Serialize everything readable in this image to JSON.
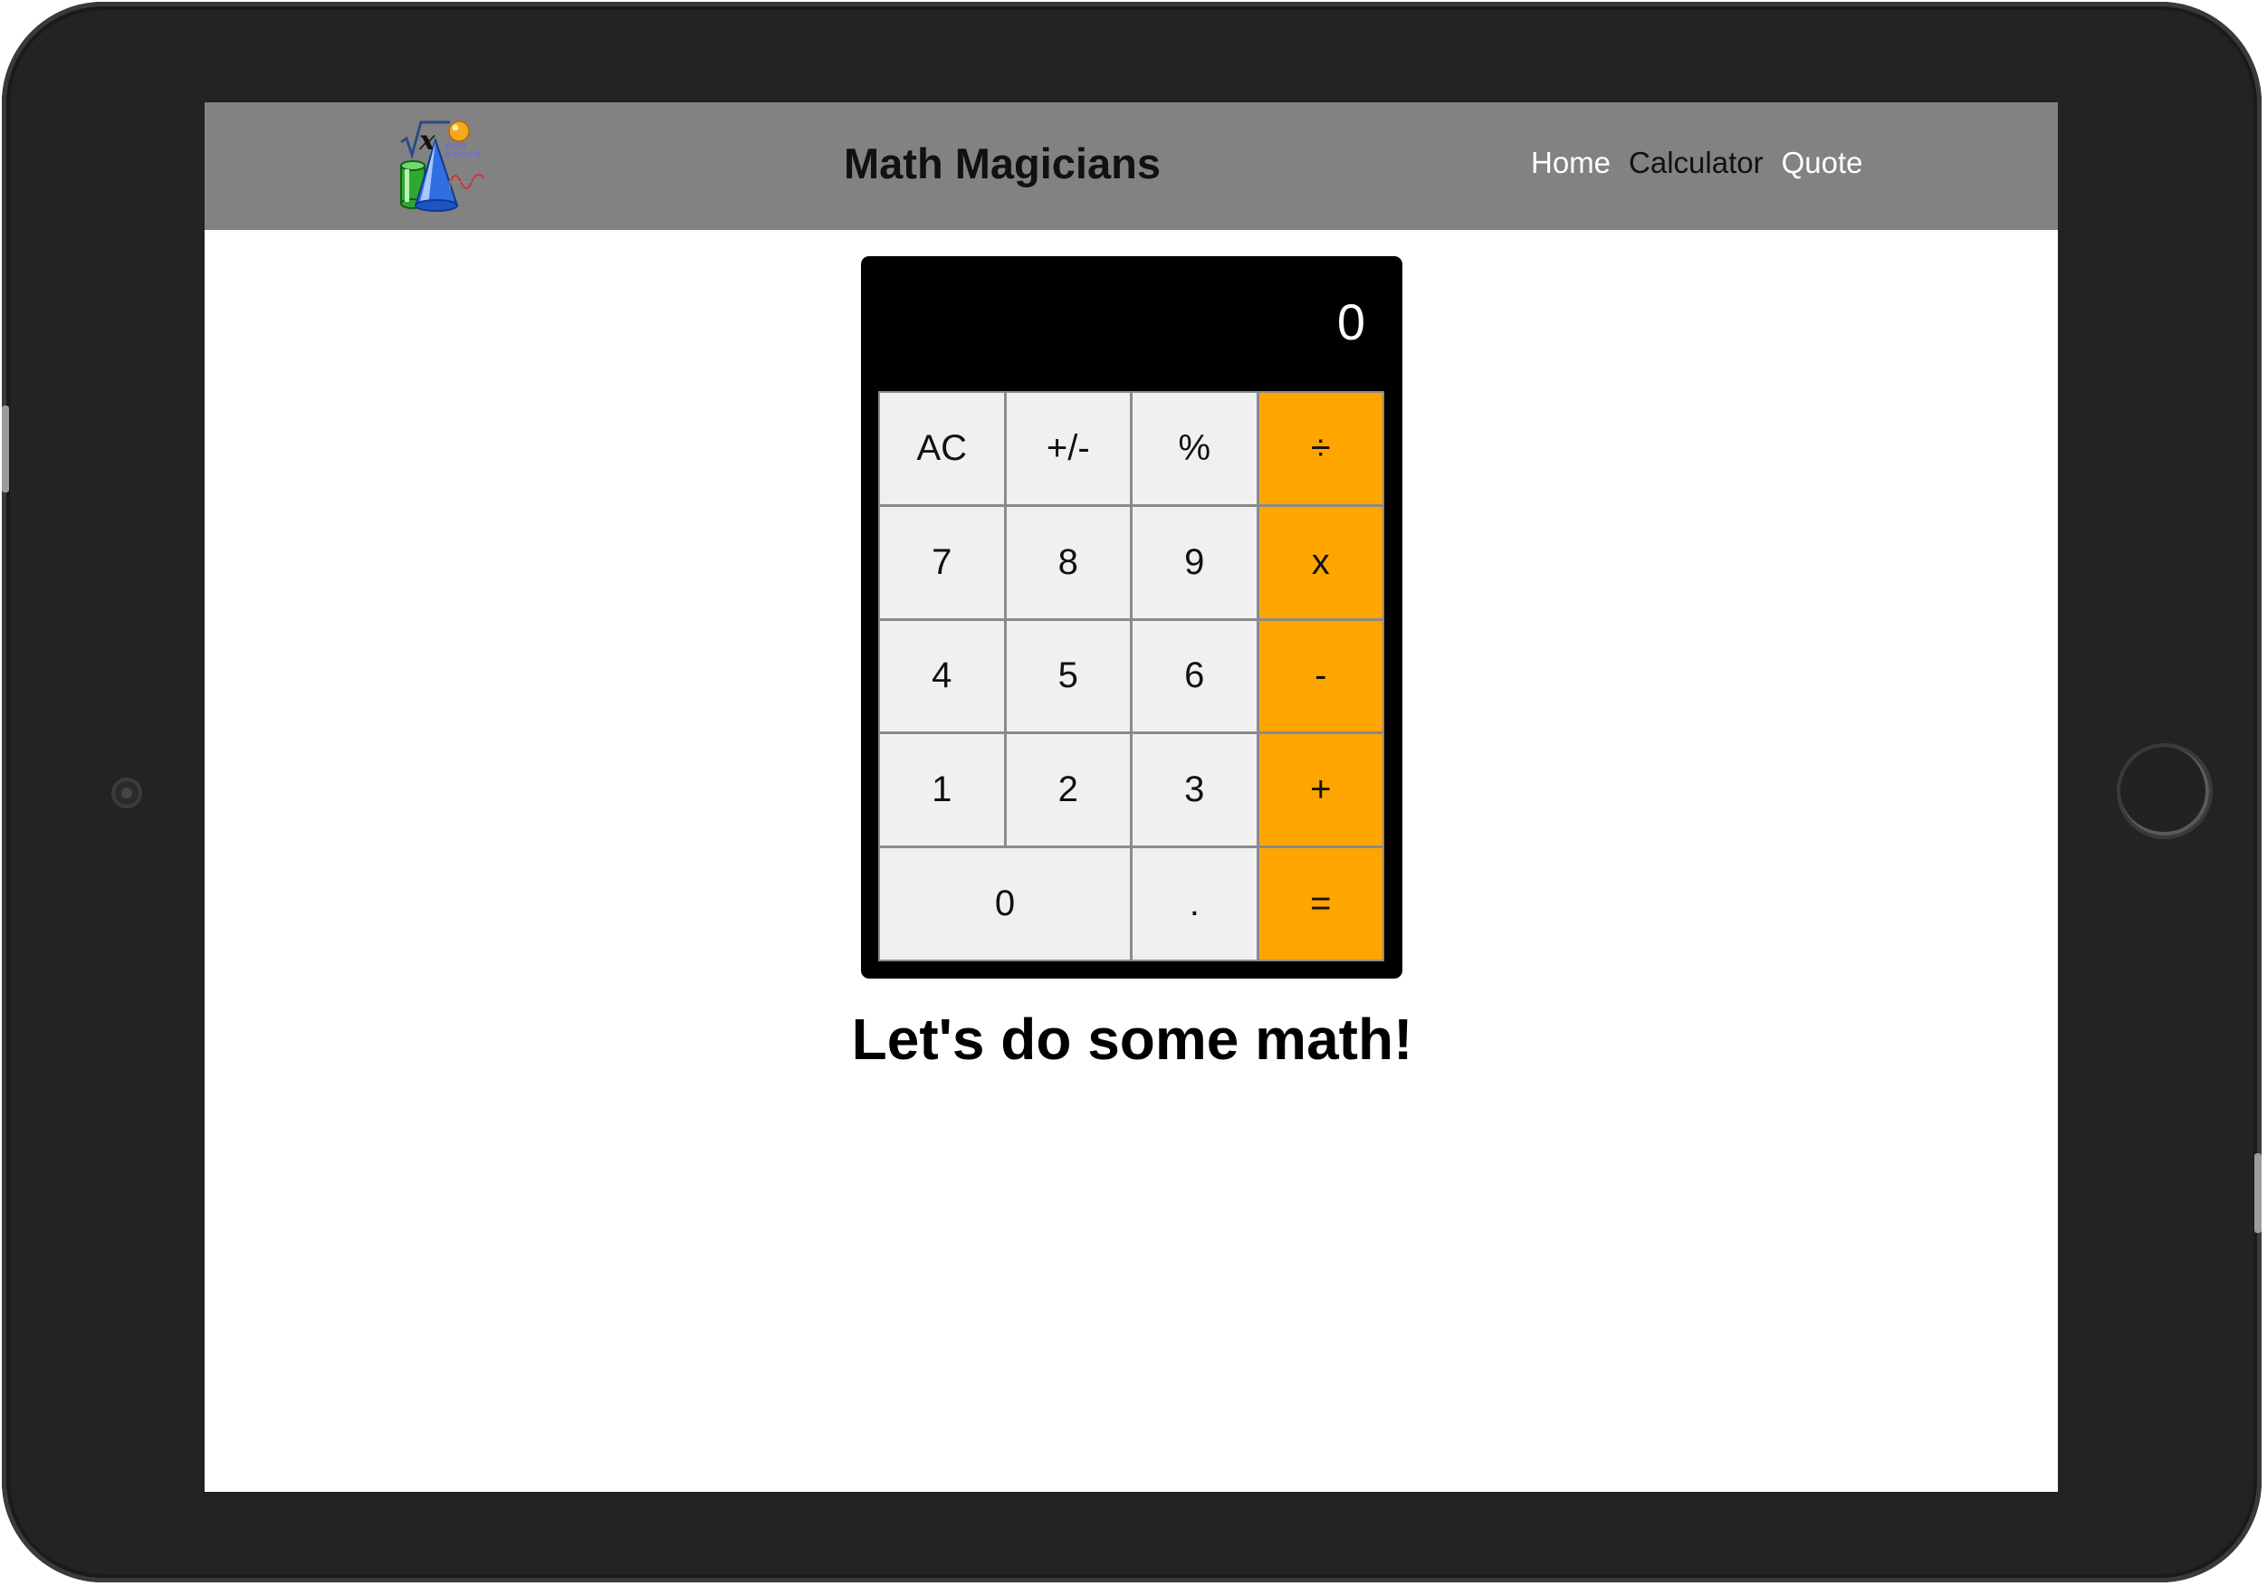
{
  "header": {
    "title": "Math Magicians",
    "logo_icon": "math-logo-icon",
    "nav": [
      {
        "label": "Home",
        "active": false
      },
      {
        "label": "Calculator",
        "active": true
      },
      {
        "label": "Quote",
        "active": false
      }
    ]
  },
  "calculator": {
    "display": "0",
    "keys": [
      {
        "label": "AC",
        "type": "function"
      },
      {
        "label": "+/-",
        "type": "function"
      },
      {
        "label": "%",
        "type": "function"
      },
      {
        "label": "÷",
        "type": "operator"
      },
      {
        "label": "7",
        "type": "digit"
      },
      {
        "label": "8",
        "type": "digit"
      },
      {
        "label": "9",
        "type": "digit"
      },
      {
        "label": "x",
        "type": "operator"
      },
      {
        "label": "4",
        "type": "digit"
      },
      {
        "label": "5",
        "type": "digit"
      },
      {
        "label": "6",
        "type": "digit"
      },
      {
        "label": "-",
        "type": "operator"
      },
      {
        "label": "1",
        "type": "digit"
      },
      {
        "label": "2",
        "type": "digit"
      },
      {
        "label": "3",
        "type": "digit"
      },
      {
        "label": "+",
        "type": "operator"
      },
      {
        "label": "0",
        "type": "digit",
        "wide": true
      },
      {
        "label": ".",
        "type": "digit"
      },
      {
        "label": "=",
        "type": "operator"
      }
    ]
  },
  "main": {
    "tagline": "Let's do some math!"
  },
  "colors": {
    "navbar": "#828282",
    "operator": "#ffa500",
    "key": "#f0f0f0",
    "calculator_body": "#000000"
  }
}
